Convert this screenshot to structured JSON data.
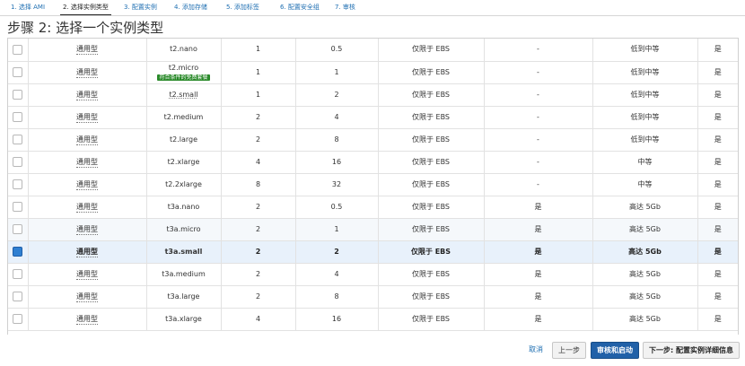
{
  "steps": [
    "1. 选择 AMI",
    "2. 选择实例类型",
    "3. 配置实例",
    "4. 添加存储",
    "5. 添加标签",
    "6. 配置安全组",
    "7. 审核"
  ],
  "title": "步骤 2: 选择一个实例类型",
  "free_tier_badge": "符合条件的免费套餐",
  "rows": [
    {
      "family": "通用型",
      "type": "t2.nano",
      "vcpu": "1",
      "mem": "0.5",
      "storage": "仅限于 EBS",
      "ebs_opt": "-",
      "network": "低到中等",
      "ipv6": "是",
      "selected": false
    },
    {
      "family": "通用型",
      "type": "t2.micro",
      "vcpu": "1",
      "mem": "1",
      "storage": "仅限于 EBS",
      "ebs_opt": "-",
      "network": "低到中等",
      "ipv6": "是",
      "selected": false,
      "free": true
    },
    {
      "family": "通用型",
      "type": "t2.small",
      "vcpu": "1",
      "mem": "2",
      "storage": "仅限于 EBS",
      "ebs_opt": "-",
      "network": "低到中等",
      "ipv6": "是",
      "selected": false
    },
    {
      "family": "通用型",
      "type": "t2.medium",
      "vcpu": "2",
      "mem": "4",
      "storage": "仅限于 EBS",
      "ebs_opt": "-",
      "network": "低到中等",
      "ipv6": "是",
      "selected": false
    },
    {
      "family": "通用型",
      "type": "t2.large",
      "vcpu": "2",
      "mem": "8",
      "storage": "仅限于 EBS",
      "ebs_opt": "-",
      "network": "低到中等",
      "ipv6": "是",
      "selected": false
    },
    {
      "family": "通用型",
      "type": "t2.xlarge",
      "vcpu": "4",
      "mem": "16",
      "storage": "仅限于 EBS",
      "ebs_opt": "-",
      "network": "中等",
      "ipv6": "是",
      "selected": false
    },
    {
      "family": "通用型",
      "type": "t2.2xlarge",
      "vcpu": "8",
      "mem": "32",
      "storage": "仅限于 EBS",
      "ebs_opt": "-",
      "network": "中等",
      "ipv6": "是",
      "selected": false
    },
    {
      "family": "通用型",
      "type": "t3a.nano",
      "vcpu": "2",
      "mem": "0.5",
      "storage": "仅限于 EBS",
      "ebs_opt": "是",
      "network": "高达 5Gb",
      "ipv6": "是",
      "selected": false
    },
    {
      "family": "通用型",
      "type": "t3a.micro",
      "vcpu": "2",
      "mem": "1",
      "storage": "仅限于 EBS",
      "ebs_opt": "是",
      "network": "高达 5Gb",
      "ipv6": "是",
      "selected": false,
      "hover": true
    },
    {
      "family": "通用型",
      "type": "t3a.small",
      "vcpu": "2",
      "mem": "2",
      "storage": "仅限于 EBS",
      "ebs_opt": "是",
      "network": "高达 5Gb",
      "ipv6": "是",
      "selected": true
    },
    {
      "family": "通用型",
      "type": "t3a.medium",
      "vcpu": "2",
      "mem": "4",
      "storage": "仅限于 EBS",
      "ebs_opt": "是",
      "network": "高达 5Gb",
      "ipv6": "是",
      "selected": false
    },
    {
      "family": "通用型",
      "type": "t3a.large",
      "vcpu": "2",
      "mem": "8",
      "storage": "仅限于 EBS",
      "ebs_opt": "是",
      "network": "高达 5Gb",
      "ipv6": "是",
      "selected": false
    },
    {
      "family": "通用型",
      "type": "t3a.xlarge",
      "vcpu": "4",
      "mem": "16",
      "storage": "仅限于 EBS",
      "ebs_opt": "是",
      "network": "高达 5Gb",
      "ipv6": "是",
      "selected": false
    }
  ],
  "footer": {
    "cancel": "取消",
    "previous": "上一步",
    "review_launch": "审核和启动",
    "next": "下一步: 配置实例详细信息"
  },
  "colors": {
    "link": "#1f6fb2",
    "primary": "#2161a8",
    "selected_row": "#e8f1fb",
    "free_badge": "#2a8a2a"
  }
}
